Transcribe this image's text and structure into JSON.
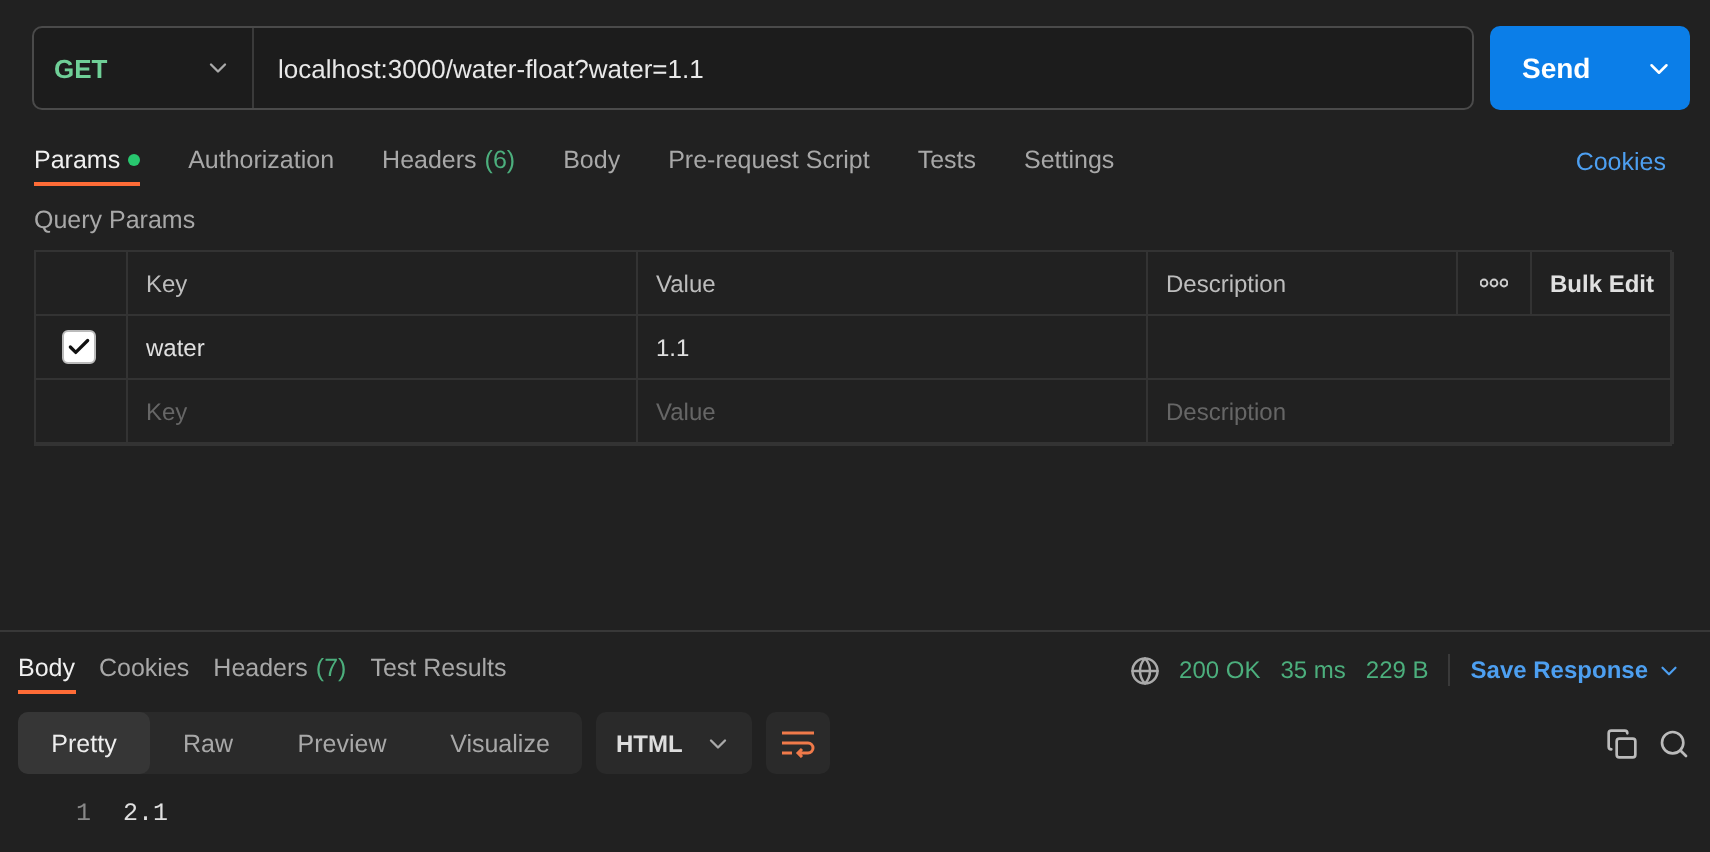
{
  "request": {
    "method": "GET",
    "url": "localhost:3000/water-float?water=1.1",
    "send_label": "Send"
  },
  "request_tabs": [
    {
      "label": "Params",
      "selected": true,
      "modified": true
    },
    {
      "label": "Authorization",
      "selected": false
    },
    {
      "label": "Headers",
      "count": "(6)",
      "selected": false
    },
    {
      "label": "Body",
      "selected": false
    },
    {
      "label": "Pre-request Script",
      "selected": false
    },
    {
      "label": "Tests",
      "selected": false
    },
    {
      "label": "Settings",
      "selected": false
    }
  ],
  "cookies_link": "Cookies",
  "query_params": {
    "title": "Query Params",
    "columns": [
      "Key",
      "Value",
      "Description"
    ],
    "bulk_edit": "Bulk Edit",
    "rows": [
      {
        "checked": true,
        "key": "water",
        "value": "1.1"
      }
    ],
    "new_row": {
      "key_placeholder": "Key",
      "value_placeholder": "Value",
      "description_placeholder": "Description"
    }
  },
  "response_tabs": [
    {
      "label": "Body",
      "selected": true
    },
    {
      "label": "Cookies",
      "selected": false
    },
    {
      "label": "Headers",
      "count": "(7)",
      "selected": false
    },
    {
      "label": "Test Results",
      "selected": false
    }
  ],
  "response_meta": {
    "status": "200 OK",
    "time": "35 ms",
    "size": "229 B",
    "save": "Save Response"
  },
  "view_modes": [
    {
      "label": "Pretty",
      "selected": true
    },
    {
      "label": "Raw",
      "selected": false
    },
    {
      "label": "Preview",
      "selected": false
    },
    {
      "label": "Visualize",
      "selected": false
    }
  ],
  "format": "HTML",
  "code_lines": [
    {
      "number": "1",
      "text": "2.1"
    }
  ]
}
